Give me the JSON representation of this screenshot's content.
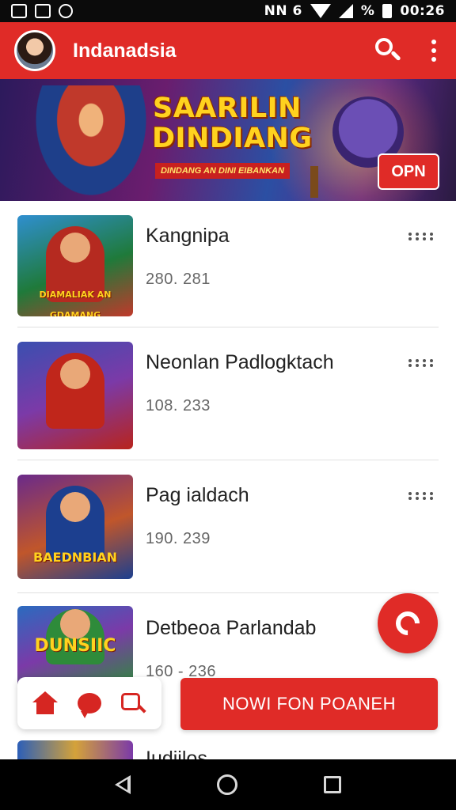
{
  "status_bar": {
    "left_icons": [
      "gallery-icon",
      "cat-icon",
      "sync-icon"
    ],
    "network_text": "NN 6",
    "battery_text": "%",
    "time": "00:26"
  },
  "app_bar": {
    "title": "Indanadsia",
    "icons": [
      "avatar",
      "search-icon",
      "more-vert-icon"
    ],
    "color": "#e02b27"
  },
  "banner": {
    "headline": "SAARILIN DINDIANG",
    "tagline": "DINDANG AN DINI EIBANKAN",
    "button_label": "OPN"
  },
  "list": {
    "items": [
      {
        "title": "Kangnipa",
        "meta": "280. 281",
        "thumb_text": "DIAMALIAK AN GDAMANG",
        "thumb_colors": [
          "#1f7a3a",
          "#c0392b"
        ]
      },
      {
        "title": "Neonlan Padlogktach",
        "meta": "108. 233",
        "thumb_text": "",
        "thumb_colors": [
          "#3a4fb0",
          "#b8241c"
        ]
      },
      {
        "title": "Pag ialdach",
        "meta": "190. 239",
        "thumb_text": "BAEDNBIAN",
        "thumb_colors": [
          "#6a2a8a",
          "#1c3f8f"
        ]
      },
      {
        "title": "Detbeoa Parlandab",
        "meta": "160 - 236",
        "thumb_text": "DUNSIIC",
        "thumb_colors": [
          "#2a6bbf",
          "#2e8b3a"
        ]
      }
    ],
    "peek_item_title": "Iudiilos"
  },
  "fab": {
    "icon": "refresh-icon"
  },
  "bottom_nav": {
    "icons": [
      "home-icon",
      "chat-icon",
      "search-icon"
    ],
    "color": "#d62622"
  },
  "cta": {
    "label": "NOWI FON POANEH"
  },
  "system_nav": {
    "icons": [
      "back-icon",
      "home-icon",
      "recents-icon"
    ]
  }
}
